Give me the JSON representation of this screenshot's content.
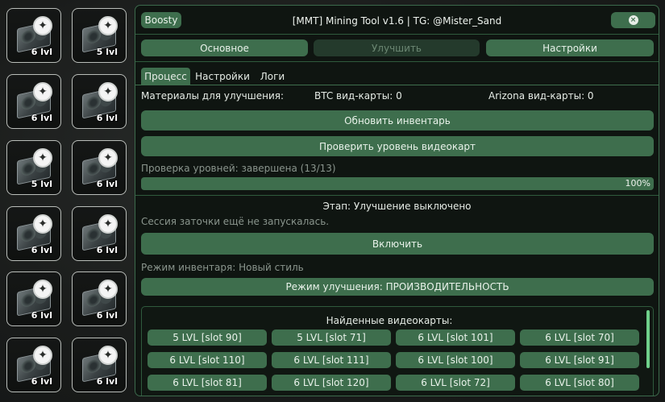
{
  "inventory": [
    {
      "level": "6 lvl"
    },
    {
      "level": "5 lvl"
    },
    {
      "level": "6 lvl"
    },
    {
      "level": "6 lvl"
    },
    {
      "level": "5 lvl"
    },
    {
      "level": "6 lvl"
    },
    {
      "level": "6 lvl"
    },
    {
      "level": "6 lvl"
    },
    {
      "level": "6 lvl"
    },
    {
      "level": "6 lvl"
    },
    {
      "level": "6 lvl"
    },
    {
      "level": "6 lvl"
    }
  ],
  "window": {
    "title": "[MMT] Mining Tool v1.6 | TG: @Mister_Sand",
    "boosty_label": "Boosty",
    "close_glyph": "×"
  },
  "main_tabs": [
    {
      "label": "Основное"
    },
    {
      "label": "Улучшить"
    },
    {
      "label": "Настройки"
    }
  ],
  "sub_tabs": [
    {
      "label": "Процесс"
    },
    {
      "label": "Настройки"
    },
    {
      "label": "Логи"
    }
  ],
  "materials": {
    "label": "Материалы для улучшения:",
    "btc": "BTC вид-карты:  0",
    "arizona": "Arizona вид-карты:  0"
  },
  "buttons": {
    "refresh_inventory": "Обновить инвентарь",
    "check_levels": "Проверить уровень видеокарт",
    "enable": "Включить",
    "upgrade_mode": "Режим улучшения: ПРОИЗВОДИТЕЛЬНОСТЬ"
  },
  "status": {
    "level_check": "Проверка уровней: завершена (13/13)",
    "progress_percent": 100,
    "progress_text": "100%",
    "stage": "Этап: Улучшение выключено",
    "session": "Сессия заточки ещё не запускалась.",
    "inventory_mode": "Режим инвентаря: Новый стиль"
  },
  "found": {
    "title": "Найденные видеокарты:",
    "cards": [
      "5 LVL [slot 90]",
      "5 LVL [slot 71]",
      "6 LVL [slot 101]",
      "6 LVL [slot 70]",
      "6 LVL [slot 110]",
      "6 LVL [slot 111]",
      "6 LVL [slot 100]",
      "6 LVL [slot 91]",
      "6 LVL [slot 81]",
      "6 LVL [slot 120]",
      "6 LVL [slot 72]",
      "6 LVL [slot 80]"
    ]
  },
  "colors": {
    "accent": "#3e6e4d",
    "panel_bg": "#0f1511",
    "scrollbar": "#6fd08a"
  }
}
